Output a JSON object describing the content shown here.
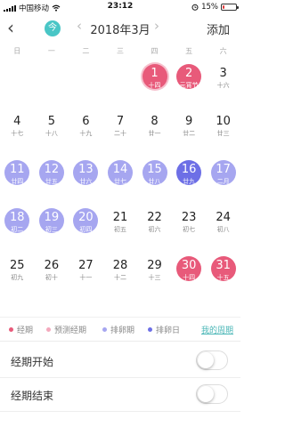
{
  "status_bar": {
    "carrier": "中国移动",
    "time": "23:12",
    "battery_text": "15%",
    "battery_level": 0.15,
    "battery_color": "#e23b3b"
  },
  "header": {
    "back_icon": "chevron-left-icon",
    "today_label": "今",
    "month_title": "2018年3月",
    "add_label": "添加"
  },
  "weekdays": [
    "日",
    "一",
    "二",
    "三",
    "四",
    "五",
    "六"
  ],
  "calendar": {
    "leading_blanks": 4,
    "days": [
      {
        "day": "1",
        "sub": "十四",
        "state": "period",
        "ring": true
      },
      {
        "day": "2",
        "sub": "元宵节",
        "state": "period"
      },
      {
        "day": "3",
        "sub": "十六",
        "state": ""
      },
      {
        "day": "4",
        "sub": "十七",
        "state": ""
      },
      {
        "day": "5",
        "sub": "十八",
        "state": ""
      },
      {
        "day": "6",
        "sub": "十九",
        "state": ""
      },
      {
        "day": "7",
        "sub": "二十",
        "state": ""
      },
      {
        "day": "8",
        "sub": "廿一",
        "state": ""
      },
      {
        "day": "9",
        "sub": "廿二",
        "state": ""
      },
      {
        "day": "10",
        "sub": "廿三",
        "state": ""
      },
      {
        "day": "11",
        "sub": "廿四",
        "state": "fertile"
      },
      {
        "day": "12",
        "sub": "廿五",
        "state": "fertile"
      },
      {
        "day": "13",
        "sub": "廿六",
        "state": "fertile"
      },
      {
        "day": "14",
        "sub": "廿七",
        "state": "fertile"
      },
      {
        "day": "15",
        "sub": "廿八",
        "state": "fertile"
      },
      {
        "day": "16",
        "sub": "廿九",
        "state": "ovulation"
      },
      {
        "day": "17",
        "sub": "二月",
        "state": "fertile"
      },
      {
        "day": "18",
        "sub": "初二",
        "state": "fertile"
      },
      {
        "day": "19",
        "sub": "初三",
        "state": "fertile"
      },
      {
        "day": "20",
        "sub": "初四",
        "state": "fertile"
      },
      {
        "day": "21",
        "sub": "初五",
        "state": ""
      },
      {
        "day": "22",
        "sub": "初六",
        "state": ""
      },
      {
        "day": "23",
        "sub": "初七",
        "state": ""
      },
      {
        "day": "24",
        "sub": "初八",
        "state": ""
      },
      {
        "day": "25",
        "sub": "初九",
        "state": ""
      },
      {
        "day": "26",
        "sub": "初十",
        "state": ""
      },
      {
        "day": "27",
        "sub": "十一",
        "state": ""
      },
      {
        "day": "28",
        "sub": "十二",
        "state": ""
      },
      {
        "day": "29",
        "sub": "十三",
        "state": ""
      },
      {
        "day": "30",
        "sub": "十四",
        "state": "period"
      },
      {
        "day": "31",
        "sub": "十五",
        "state": "period"
      }
    ]
  },
  "legend": {
    "items": [
      {
        "label": "经期",
        "color": "#e85a7a"
      },
      {
        "label": "预测经期",
        "color": "#f4a9bd"
      },
      {
        "label": "排卵期",
        "color": "#a6a6f0"
      },
      {
        "label": "排卵日",
        "color": "#6d6fe6"
      }
    ],
    "my_cycle": "我的周期"
  },
  "settings": {
    "period_start": {
      "label": "经期开始",
      "on": false
    },
    "period_end": {
      "label": "经期结束",
      "on": false
    }
  }
}
